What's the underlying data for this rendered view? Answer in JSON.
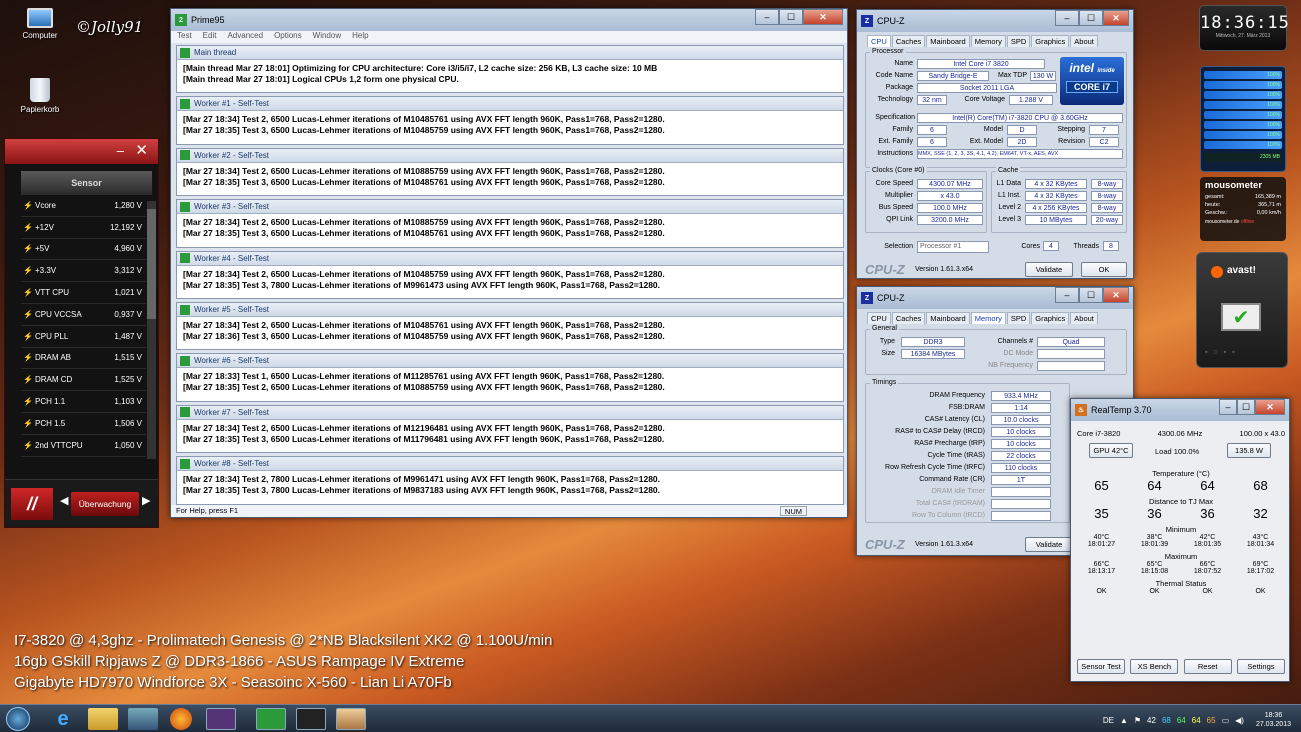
{
  "desktop": {
    "signature": "©Jolly91",
    "icons": [
      {
        "label": "Computer"
      },
      {
        "label": "Papierkorb"
      }
    ],
    "spec_lines": [
      "I7-3820 @ 4,3ghz - Prolimatech Genesis @ 2*NB Blacksilent XK2 @ 1.100U/min",
      "16gb GSkill Ripjaws Z @ DDR3-1866 - ASUS Rampage IV Extreme",
      "Gigabyte HD7970 Windforce 3X - Seasoinc X-560 - Lian Li A70Fb"
    ]
  },
  "clock": {
    "time": "18:36:15",
    "date": "Mittwoch, 27. März 2013"
  },
  "cpu_meter": {
    "cores": [
      "100%",
      "100%",
      "100%",
      "100%",
      "100%",
      "100%",
      "100%",
      "100%"
    ],
    "mem": "2305 MB"
  },
  "mousometer": {
    "title": "mousometer",
    "rows": [
      {
        "k": "gesamt:",
        "v": "165,389 m"
      },
      {
        "k": "heute:",
        "v": "365,71 m"
      },
      {
        "k": "Geschw.:",
        "v": "0,00 km/h"
      }
    ],
    "footer": "mousometer.de",
    "status": "offline"
  },
  "avast": {
    "label": "avast!"
  },
  "prime95": {
    "title": "Prime95",
    "menu": [
      "Test",
      "Edit",
      "Advanced",
      "Options",
      "Window",
      "Help"
    ],
    "status_left": "For Help, press F1",
    "status_num": "NUM",
    "panes": [
      {
        "title": "Main thread",
        "lines": [
          "[Main thread Mar 27 18:01] Optimizing for CPU architecture: Core i3/i5/i7, L2 cache size: 256 KB, L3 cache size: 10 MB",
          "[Main thread Mar 27 18:01] Logical CPUs 1,2 form one physical CPU."
        ]
      },
      {
        "title": "Worker #1 - Self-Test",
        "lines": [
          "[Mar 27 18:34] Test 2, 6500 Lucas-Lehmer iterations of M10485761 using AVX FFT length 960K, Pass1=768, Pass2=1280.",
          "[Mar 27 18:35] Test 3, 6500 Lucas-Lehmer iterations of M10485759 using AVX FFT length 960K, Pass1=768, Pass2=1280."
        ]
      },
      {
        "title": "Worker #2 - Self-Test",
        "lines": [
          "[Mar 27 18:34] Test 2, 6500 Lucas-Lehmer iterations of M10885759 using AVX FFT length 960K, Pass1=768, Pass2=1280.",
          "[Mar 27 18:35] Test 3, 6500 Lucas-Lehmer iterations of M10485761 using AVX FFT length 960K, Pass1=768, Pass2=1280."
        ]
      },
      {
        "title": "Worker #3 - Self-Test",
        "lines": [
          "[Mar 27 18:34] Test 2, 6500 Lucas-Lehmer iterations of M10885759 using AVX FFT length 960K, Pass1=768, Pass2=1280.",
          "[Mar 27 18:35] Test 3, 6500 Lucas-Lehmer iterations of M10485761 using AVX FFT length 960K, Pass1=768, Pass2=1280."
        ]
      },
      {
        "title": "Worker #4 - Self-Test",
        "lines": [
          "[Mar 27 18:34] Test 2, 6500 Lucas-Lehmer iterations of M10485759 using AVX FFT length 960K, Pass1=768, Pass2=1280.",
          "[Mar 27 18:35] Test 3, 7800 Lucas-Lehmer iterations of M9961473 using AVX FFT length 960K, Pass1=768, Pass2=1280."
        ]
      },
      {
        "title": "Worker #5 - Self-Test",
        "lines": [
          "[Mar 27 18:34] Test 2, 6500 Lucas-Lehmer iterations of M10485761 using AVX FFT length 960K, Pass1=768, Pass2=1280.",
          "[Mar 27 18:36] Test 3, 6500 Lucas-Lehmer iterations of M10485759 using AVX FFT length 960K, Pass1=768, Pass2=1280."
        ]
      },
      {
        "title": "Worker #6 - Self-Test",
        "lines": [
          "[Mar 27 18:33] Test 1, 6500 Lucas-Lehmer iterations of M11285761 using AVX FFT length 960K, Pass1=768, Pass2=1280.",
          "[Mar 27 18:35] Test 2, 6500 Lucas-Lehmer iterations of M10885759 using AVX FFT length 960K, Pass1=768, Pass2=1280."
        ]
      },
      {
        "title": "Worker #7 - Self-Test",
        "lines": [
          "[Mar 27 18:34] Test 2, 6500 Lucas-Lehmer iterations of M12196481 using AVX FFT length 960K, Pass1=768, Pass2=1280.",
          "[Mar 27 18:35] Test 3, 6500 Lucas-Lehmer iterations of M11796481 using AVX FFT length 960K, Pass1=768, Pass2=1280."
        ]
      },
      {
        "title": "Worker #8 - Self-Test",
        "lines": [
          "[Mar 27 18:34] Test 2, 7800 Lucas-Lehmer iterations of M9961471 using AVX FFT length 960K, Pass1=768, Pass2=1280.",
          "[Mar 27 18:35] Test 3, 7800 Lucas-Lehmer iterations of M9837183 using AVX FFT length 960K, Pass1=768, Pass2=1280."
        ]
      }
    ]
  },
  "sensor": {
    "header": "Sensor",
    "footer_label": "Überwachung",
    "rows": [
      {
        "n": "Vcore",
        "v": "1,280 V"
      },
      {
        "n": "+12V",
        "v": "12,192 V"
      },
      {
        "n": "+5V",
        "v": "4,960 V"
      },
      {
        "n": "+3.3V",
        "v": "3,312 V"
      },
      {
        "n": "VTT CPU",
        "v": "1,021 V"
      },
      {
        "n": "CPU VCCSA",
        "v": "0,937 V"
      },
      {
        "n": "CPU PLL",
        "v": "1,487 V"
      },
      {
        "n": "DRAM AB",
        "v": "1,515 V"
      },
      {
        "n": "DRAM CD",
        "v": "1,525 V"
      },
      {
        "n": "PCH 1.1",
        "v": "1,103 V"
      },
      {
        "n": "PCH 1.5",
        "v": "1,506 V"
      },
      {
        "n": "2nd VTTCPU",
        "v": "1,050 V"
      }
    ]
  },
  "cpuz1": {
    "title": "CPU-Z",
    "tabs": [
      "CPU",
      "Caches",
      "Mainboard",
      "Memory",
      "SPD",
      "Graphics",
      "About"
    ],
    "processor_label": "Processor",
    "name_k": "Name",
    "name": "Intel Core i7 3820",
    "codename_k": "Code Name",
    "codename": "Sandy Bridge-E",
    "maxtdp_k": "Max TDP",
    "maxtdp": "130 W",
    "package_k": "Package",
    "package": "Socket 2011 LGA",
    "tech_k": "Technology",
    "tech": "32 nm",
    "cv_k": "Core Voltage",
    "cv": "1.288 V",
    "spec_k": "Specification",
    "spec": "Intel(R) Core(TM) i7-3820 CPU @ 3.60GHz",
    "family_k": "Family",
    "family": "6",
    "model_k": "Model",
    "model": "D",
    "stepping_k": "Stepping",
    "stepping": "7",
    "extfam_k": "Ext. Family",
    "extfam": "6",
    "extmodel_k": "Ext. Model",
    "extmodel": "2D",
    "rev_k": "Revision",
    "rev": "C2",
    "instr_k": "Instructions",
    "instr": "MMX, SSE (1, 2, 3, 3S, 4.1, 4.2), EM64T, VT-x, AES, AVX",
    "clocks_label": "Clocks (Core #0)",
    "cs_k": "Core Speed",
    "cs": "4300.07 MHz",
    "mul_k": "Multiplier",
    "mul": "x 43.0",
    "bus_k": "Bus Speed",
    "bus": "100.0 MHz",
    "qpi_k": "QPI Link",
    "qpi": "3200.0 MHz",
    "cache_label": "Cache",
    "caches": [
      {
        "k": "L1 Data",
        "v": "4 x 32 KBytes",
        "w": "8-way"
      },
      {
        "k": "L1 Inst.",
        "v": "4 x 32 KBytes",
        "w": "8-way"
      },
      {
        "k": "Level 2",
        "v": "4 x 256 KBytes",
        "w": "8-way"
      },
      {
        "k": "Level 3",
        "v": "10 MBytes",
        "w": "20-way"
      }
    ],
    "sel_k": "Selection",
    "sel": "Processor #1",
    "cores_k": "Cores",
    "cores": "4",
    "threads_k": "Threads",
    "threads": "8",
    "brand": "CPU-Z",
    "version": "Version 1.61.3.x64",
    "validate": "Validate",
    "ok": "OK",
    "logo_top": "intel",
    "logo_inside": "inside",
    "logo_bottom": "CORE i7"
  },
  "cpuz2": {
    "title": "CPU-Z",
    "tabs": [
      "CPU",
      "Caches",
      "Mainboard",
      "Memory",
      "SPD",
      "Graphics",
      "About"
    ],
    "general_label": "General",
    "type_k": "Type",
    "type": "DDR3",
    "size_k": "Size",
    "size": "16384 MBytes",
    "chan_k": "Channels #",
    "chan": "Quad",
    "dc_k": "DC Mode",
    "nb_k": "NB Frequency",
    "timings_label": "Timings",
    "timings": [
      {
        "k": "DRAM Frequency",
        "v": "933.4 MHz"
      },
      {
        "k": "FSB:DRAM",
        "v": "1:14"
      },
      {
        "k": "CAS# Latency (CL)",
        "v": "10.0 clocks"
      },
      {
        "k": "RAS# to CAS# Delay (tRCD)",
        "v": "10 clocks"
      },
      {
        "k": "RAS# Precharge (tRP)",
        "v": "10 clocks"
      },
      {
        "k": "Cycle Time (tRAS)",
        "v": "22 clocks"
      },
      {
        "k": "Row Refresh Cycle Time (tRFC)",
        "v": "110 clocks"
      },
      {
        "k": "Command Rate (CR)",
        "v": "1T"
      },
      {
        "k": "DRAM Idle Timer",
        "v": ""
      },
      {
        "k": "Total CAS# (tRDRAM)",
        "v": ""
      },
      {
        "k": "Row To Column (tRCD)",
        "v": ""
      }
    ],
    "brand": "CPU-Z",
    "version": "Version 1.61.3.x64",
    "validate": "Validate"
  },
  "realtemp": {
    "title": "RealTemp 3.70",
    "cpu": "Core i7-3820",
    "freq": "4300.06 MHz",
    "mult": "100.00 x 43.0",
    "gpu": "GPU 42°C",
    "load": "Load 100.0%",
    "watts": "135.8 W",
    "temp_label": "Temperature (°C)",
    "temps": [
      "65",
      "64",
      "64",
      "68"
    ],
    "dist_label": "Distance to TJ Max",
    "dist": [
      "35",
      "36",
      "36",
      "32"
    ],
    "min_label": "Minimum",
    "min": [
      "40°C",
      "38°C",
      "42°C",
      "43°C"
    ],
    "min_t": [
      "18:01:27",
      "18:01:39",
      "18:01:35",
      "18:01:34"
    ],
    "max_label": "Maximum",
    "max": [
      "66°C",
      "65°C",
      "66°C",
      "69°C"
    ],
    "max_t": [
      "18:13:17",
      "18:15:08",
      "18:07:52",
      "18:17:02"
    ],
    "thermal_label": "Thermal Status",
    "thermal": [
      "OK",
      "OK",
      "OK",
      "OK"
    ],
    "buttons": [
      "Sensor Test",
      "XS Bench",
      "Reset",
      "Settings"
    ]
  },
  "taskbar": {
    "lang": "DE",
    "tray_nums": [
      "42",
      "68",
      "64",
      "64",
      "65"
    ],
    "time": "18:36",
    "date": "27.03.2013"
  }
}
